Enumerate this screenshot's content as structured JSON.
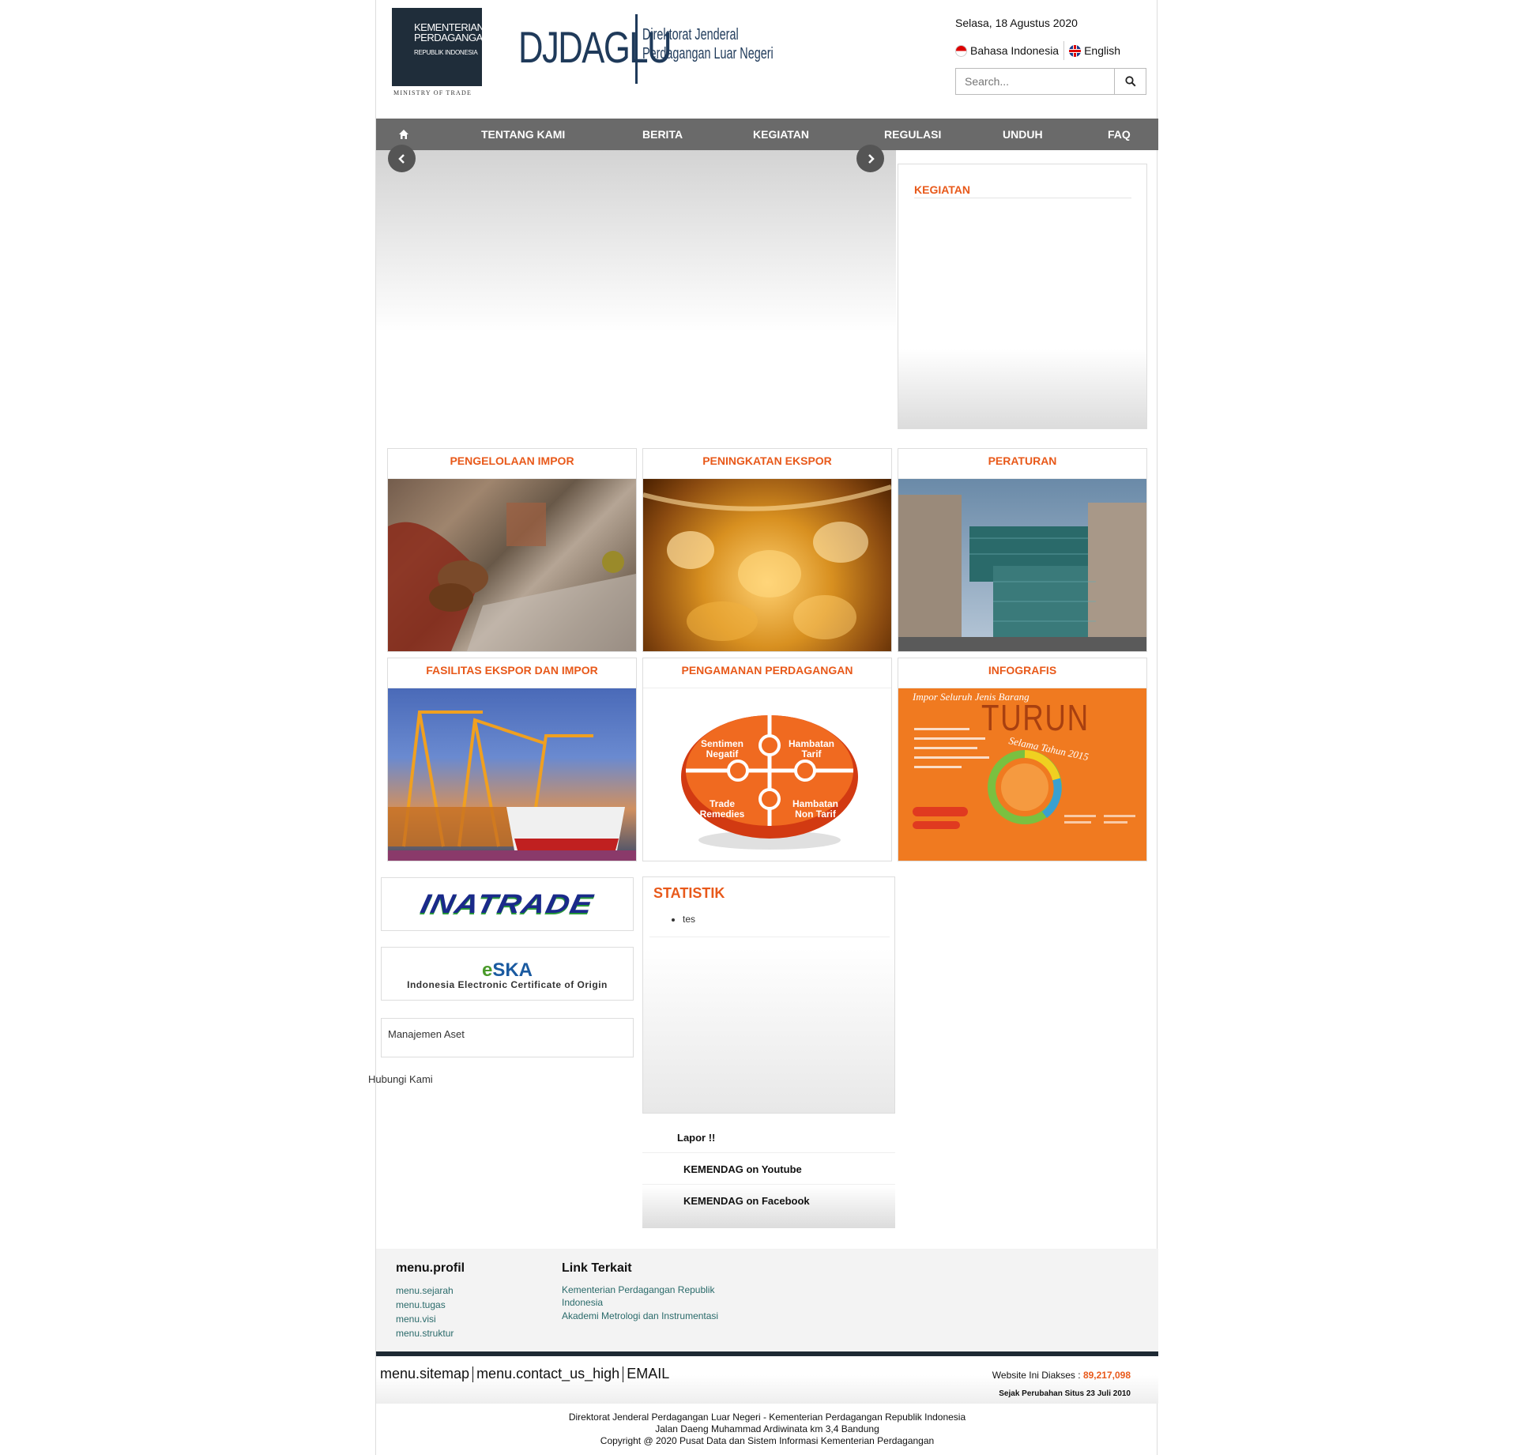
{
  "header": {
    "ministry": {
      "line1": "KEMENTERIAN",
      "line2": "PERDAGANGAN",
      "line3": "REPUBLIK INDONESIA",
      "bottom": "MINISTRY OF TRADE"
    },
    "brand": {
      "title": "DJDAGLU",
      "sub1": "Direktorat Jenderal",
      "sub2": "Perdagangan Luar Negeri"
    },
    "date": "Selasa, 18 Agustus 2020",
    "lang_id": "Bahasa Indonesia",
    "lang_en": "English",
    "search_placeholder": "Search..."
  },
  "nav": {
    "items": [
      "TENTANG KAMI",
      "BERITA",
      "KEGIATAN",
      "REGULASI",
      "UNDUH",
      "FAQ"
    ]
  },
  "kegiatan_box": {
    "title": "KEGIATAN"
  },
  "tiles": [
    {
      "title": "PENGELOLAAN IMPOR"
    },
    {
      "title": "PENINGKATAN EKSPOR"
    },
    {
      "title": "PERATURAN"
    },
    {
      "title": "FASILITAS EKSPOR DAN IMPOR"
    },
    {
      "title": "PENGAMANAN PERDAGANGAN"
    },
    {
      "title": "INFOGRAFIS"
    }
  ],
  "puzzle": {
    "p1": "Sentimen Negatif",
    "p2": "Hambatan Tarif",
    "p3": "Trade Remedies",
    "p4": "Hambatan Non Tarif"
  },
  "infographic": {
    "l1": "Impor Seluruh Jenis Barang",
    "l2": "TURUN",
    "l3": "Selama Tahun 2015"
  },
  "links": {
    "inatrade": "INATRADE",
    "eska_e": "e",
    "eska_ska": "SKA",
    "eska_sub": "Indonesia Electronic Certificate of Origin",
    "manajemen": "Manajemen Aset",
    "hubungi": "Hubungi Kami"
  },
  "statistik": {
    "title": "STATISTIK",
    "items": [
      "tes"
    ]
  },
  "social": {
    "lapor": "Lapor !!",
    "youtube": "KEMENDAG on Youtube",
    "facebook": "KEMENDAG on Facebook"
  },
  "footer": {
    "profil_title": "menu.profil",
    "profil_links": [
      "menu.sejarah",
      "menu.tugas",
      "menu.visi",
      "menu.struktur"
    ],
    "terkait_title": "Link Terkait",
    "terkait_links": [
      "Kementerian Perdagangan Republik Indonesia",
      "Akademi Metrologi dan Instrumentasi"
    ],
    "sitemap": "menu.sitemap",
    "contact": "menu.contact_us_high",
    "email": "EMAIL",
    "counter_label": "Website Ini Diakses : ",
    "counter_value": "89,217,098",
    "since": "Sejak Perubahan Situs 23 Juli 2010",
    "line1": "Direktorat Jenderal Perdagangan Luar Negeri - Kementerian Perdagangan Republik Indonesia",
    "line2": "Jalan Daeng Muhammad Ardiwinata km 3,4 Bandung",
    "line3": "Copyright @ 2020 Pusat Data dan Sistem Informasi Kementerian Perdagangan"
  },
  "colors": {
    "accent": "#e8591a",
    "nav": "#6a6a6a",
    "navy": "#1f2d3a"
  },
  "icons": [
    "home-icon",
    "search-icon",
    "chevron-left-icon",
    "chevron-right-icon"
  ]
}
